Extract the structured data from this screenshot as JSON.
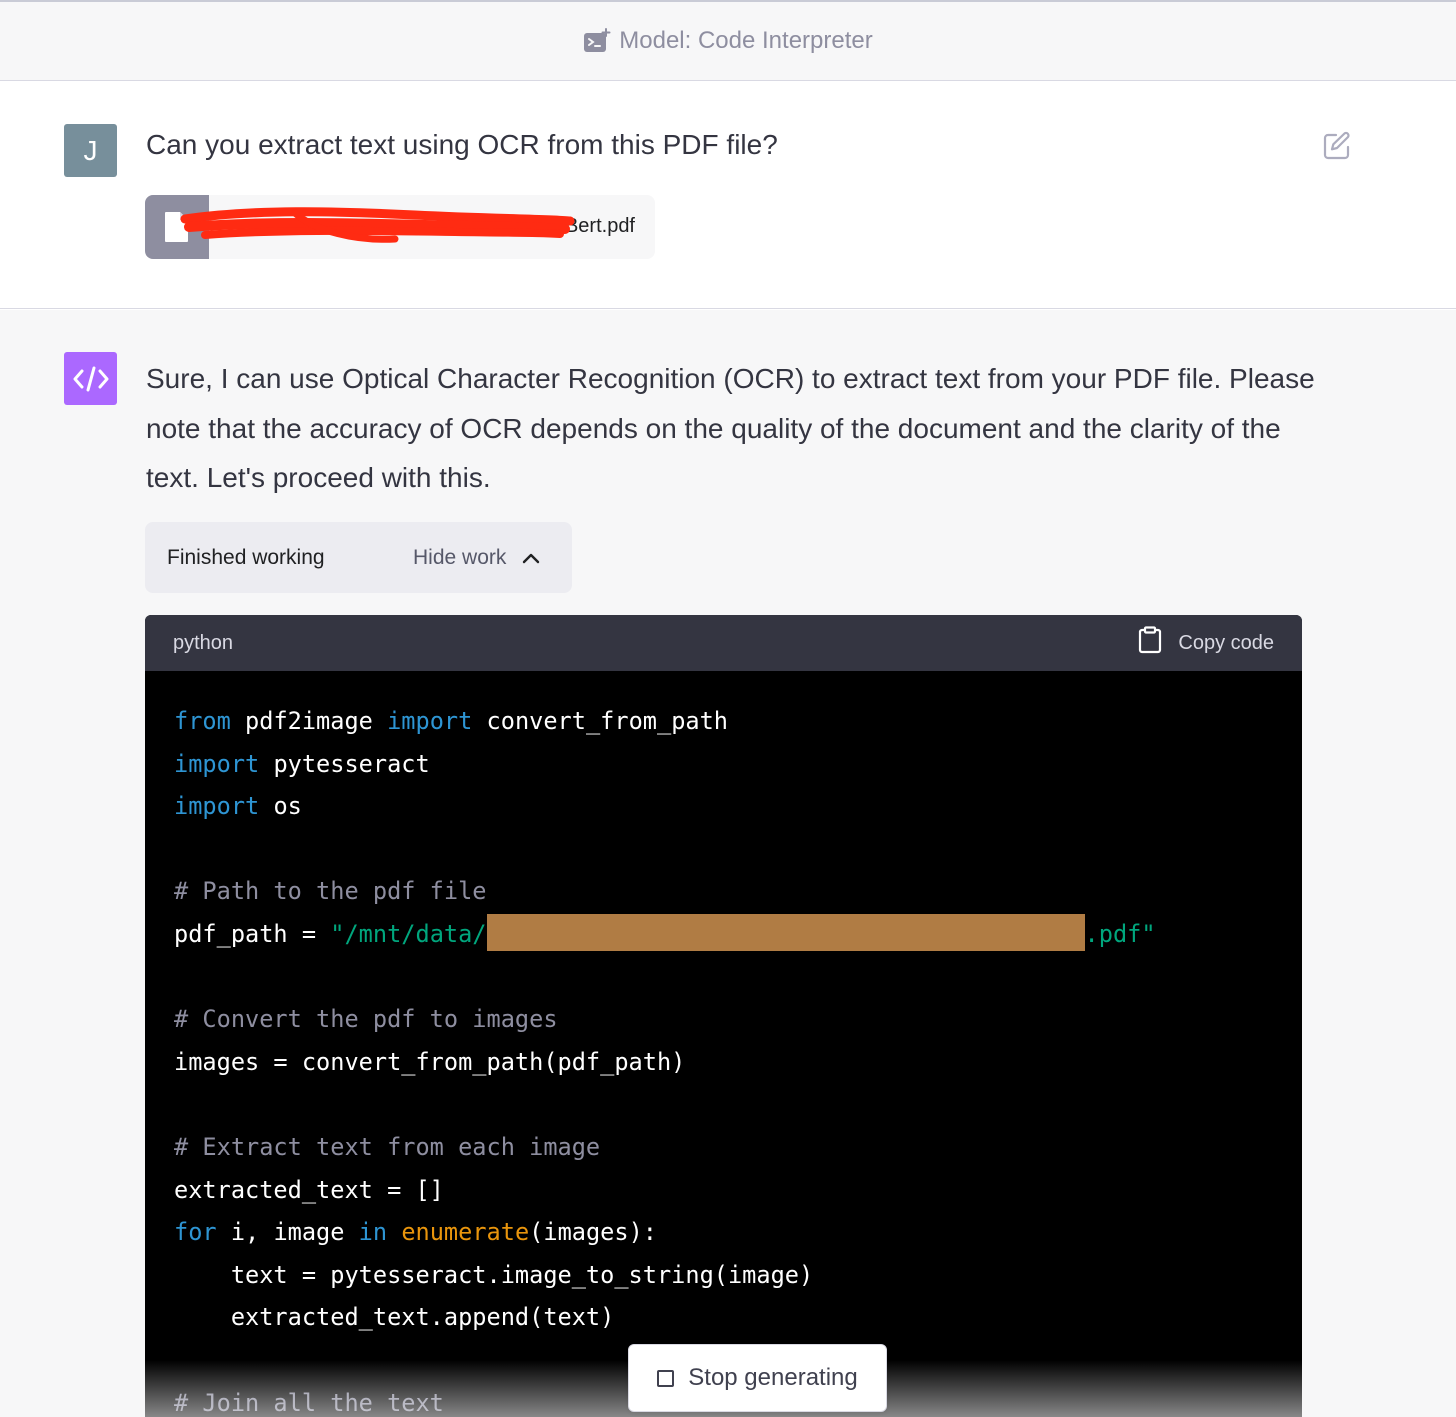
{
  "header": {
    "model_label": "Model: Code Interpreter",
    "icon": "code-interpreter-icon"
  },
  "user_message": {
    "avatar_initial": "J",
    "text": "Can you extract text using OCR from this PDF file?",
    "attachment": {
      "file_name": "Bert.pdf",
      "icon": "file-icon",
      "redacted": true
    },
    "edit_icon": "edit-icon"
  },
  "assistant_message": {
    "avatar_icon": "code-icon",
    "text": "Sure, I can use Optical Character Recognition (OCR) to extract text from your PDF file. Please note that the accuracy of OCR depends on the quality of the document and the clarity of the text. Let's proceed with this.",
    "work_status": "Finished working",
    "hide_work_label": "Hide work",
    "code": {
      "language": "python",
      "copy_label": "Copy code",
      "line1": {
        "kw1": "from",
        "mod": " pdf2image ",
        "kw2": "import",
        "name": " convert_from_path"
      },
      "line2": {
        "kw": "import",
        "name": " pytesseract"
      },
      "line3": {
        "kw": "import",
        "name": " os"
      },
      "line5": {
        "comment": "# Path to the pdf file"
      },
      "line6": {
        "lhs": "pdf_path = ",
        "str_start": "\"/mnt/data/",
        "str_end": ".pdf\""
      },
      "line8": {
        "comment": "# Convert the pdf to images"
      },
      "line9": {
        "code": "images = convert_from_path(pdf_path)"
      },
      "line11": {
        "comment": "# Extract text from each image"
      },
      "line12": {
        "code": "extracted_text = []"
      },
      "line13": {
        "kw1": "for",
        "mid": " i, image ",
        "kw2": "in",
        "sp": " ",
        "builtin": "enumerate",
        "end": "(images):"
      },
      "line14": {
        "code": "    text = pytesseract.image_to_string(image)"
      },
      "line15": {
        "code": "    extracted_text.append(text)"
      },
      "line17": {
        "comment": "# Join all the text"
      }
    }
  },
  "stop_button": {
    "label": "Stop generating",
    "icon": "stop-icon"
  },
  "colors": {
    "user_avatar": "#778f9b",
    "assistant_avatar": "#ab68ff",
    "code_keyword": "#2e95d3",
    "code_string": "#00a67d",
    "code_comment": "#8e8ea0",
    "code_builtin": "#e9950c",
    "redaction_bar": "#b07c44",
    "redaction_scribble": "#ff2b12"
  }
}
